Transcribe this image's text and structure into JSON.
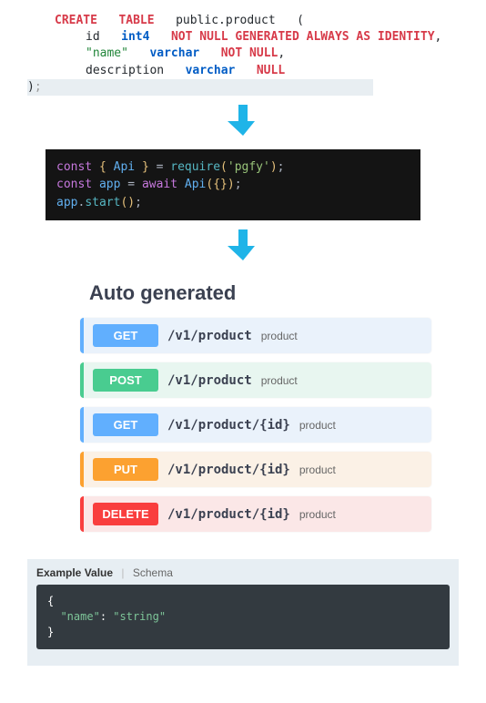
{
  "sql": {
    "create": "CREATE",
    "table": "TABLE",
    "schema": "public.product",
    "lp": "(",
    "col1_name": "id",
    "col1_type": "int4",
    "col1_rest": "NOT NULL GENERATED ALWAYS AS IDENTITY",
    "comma": ",",
    "col2_name": "\"name\"",
    "col2_type": "varchar",
    "col2_rest": "NOT NULL",
    "col3_name": "description",
    "col3_type": "varchar",
    "col3_rest": "NULL",
    "rp": ")",
    "semi": ";"
  },
  "js": {
    "const1": "const",
    "lb": "{",
    "api": "Api",
    "rb": "}",
    "eq": "=",
    "req": "require",
    "lp": "(",
    "pkg": "'pgfy'",
    "rp": ")",
    "semi": ";",
    "const2": "const",
    "app": "app",
    "await": "await",
    "obj": "{}",
    "start": "start",
    "dot": ".",
    "empty": "()"
  },
  "swagger": {
    "title": "Auto generated",
    "ops": [
      {
        "method": "GET",
        "cls": "get",
        "path": "/v1/product",
        "tag": "product"
      },
      {
        "method": "POST",
        "cls": "post",
        "path": "/v1/product",
        "tag": "product"
      },
      {
        "method": "GET",
        "cls": "get",
        "path": "/v1/product/{id}",
        "tag": "product"
      },
      {
        "method": "PUT",
        "cls": "put",
        "path": "/v1/product/{id}",
        "tag": "product"
      },
      {
        "method": "DELETE",
        "cls": "delete",
        "path": "/v1/product/{id}",
        "tag": "product"
      }
    ]
  },
  "example": {
    "tab1": "Example Value",
    "tab2": "Schema",
    "l1": "{",
    "l2k": "\"name\"",
    "l2c": ": ",
    "l2v": "\"string\"",
    "l3": "}"
  }
}
